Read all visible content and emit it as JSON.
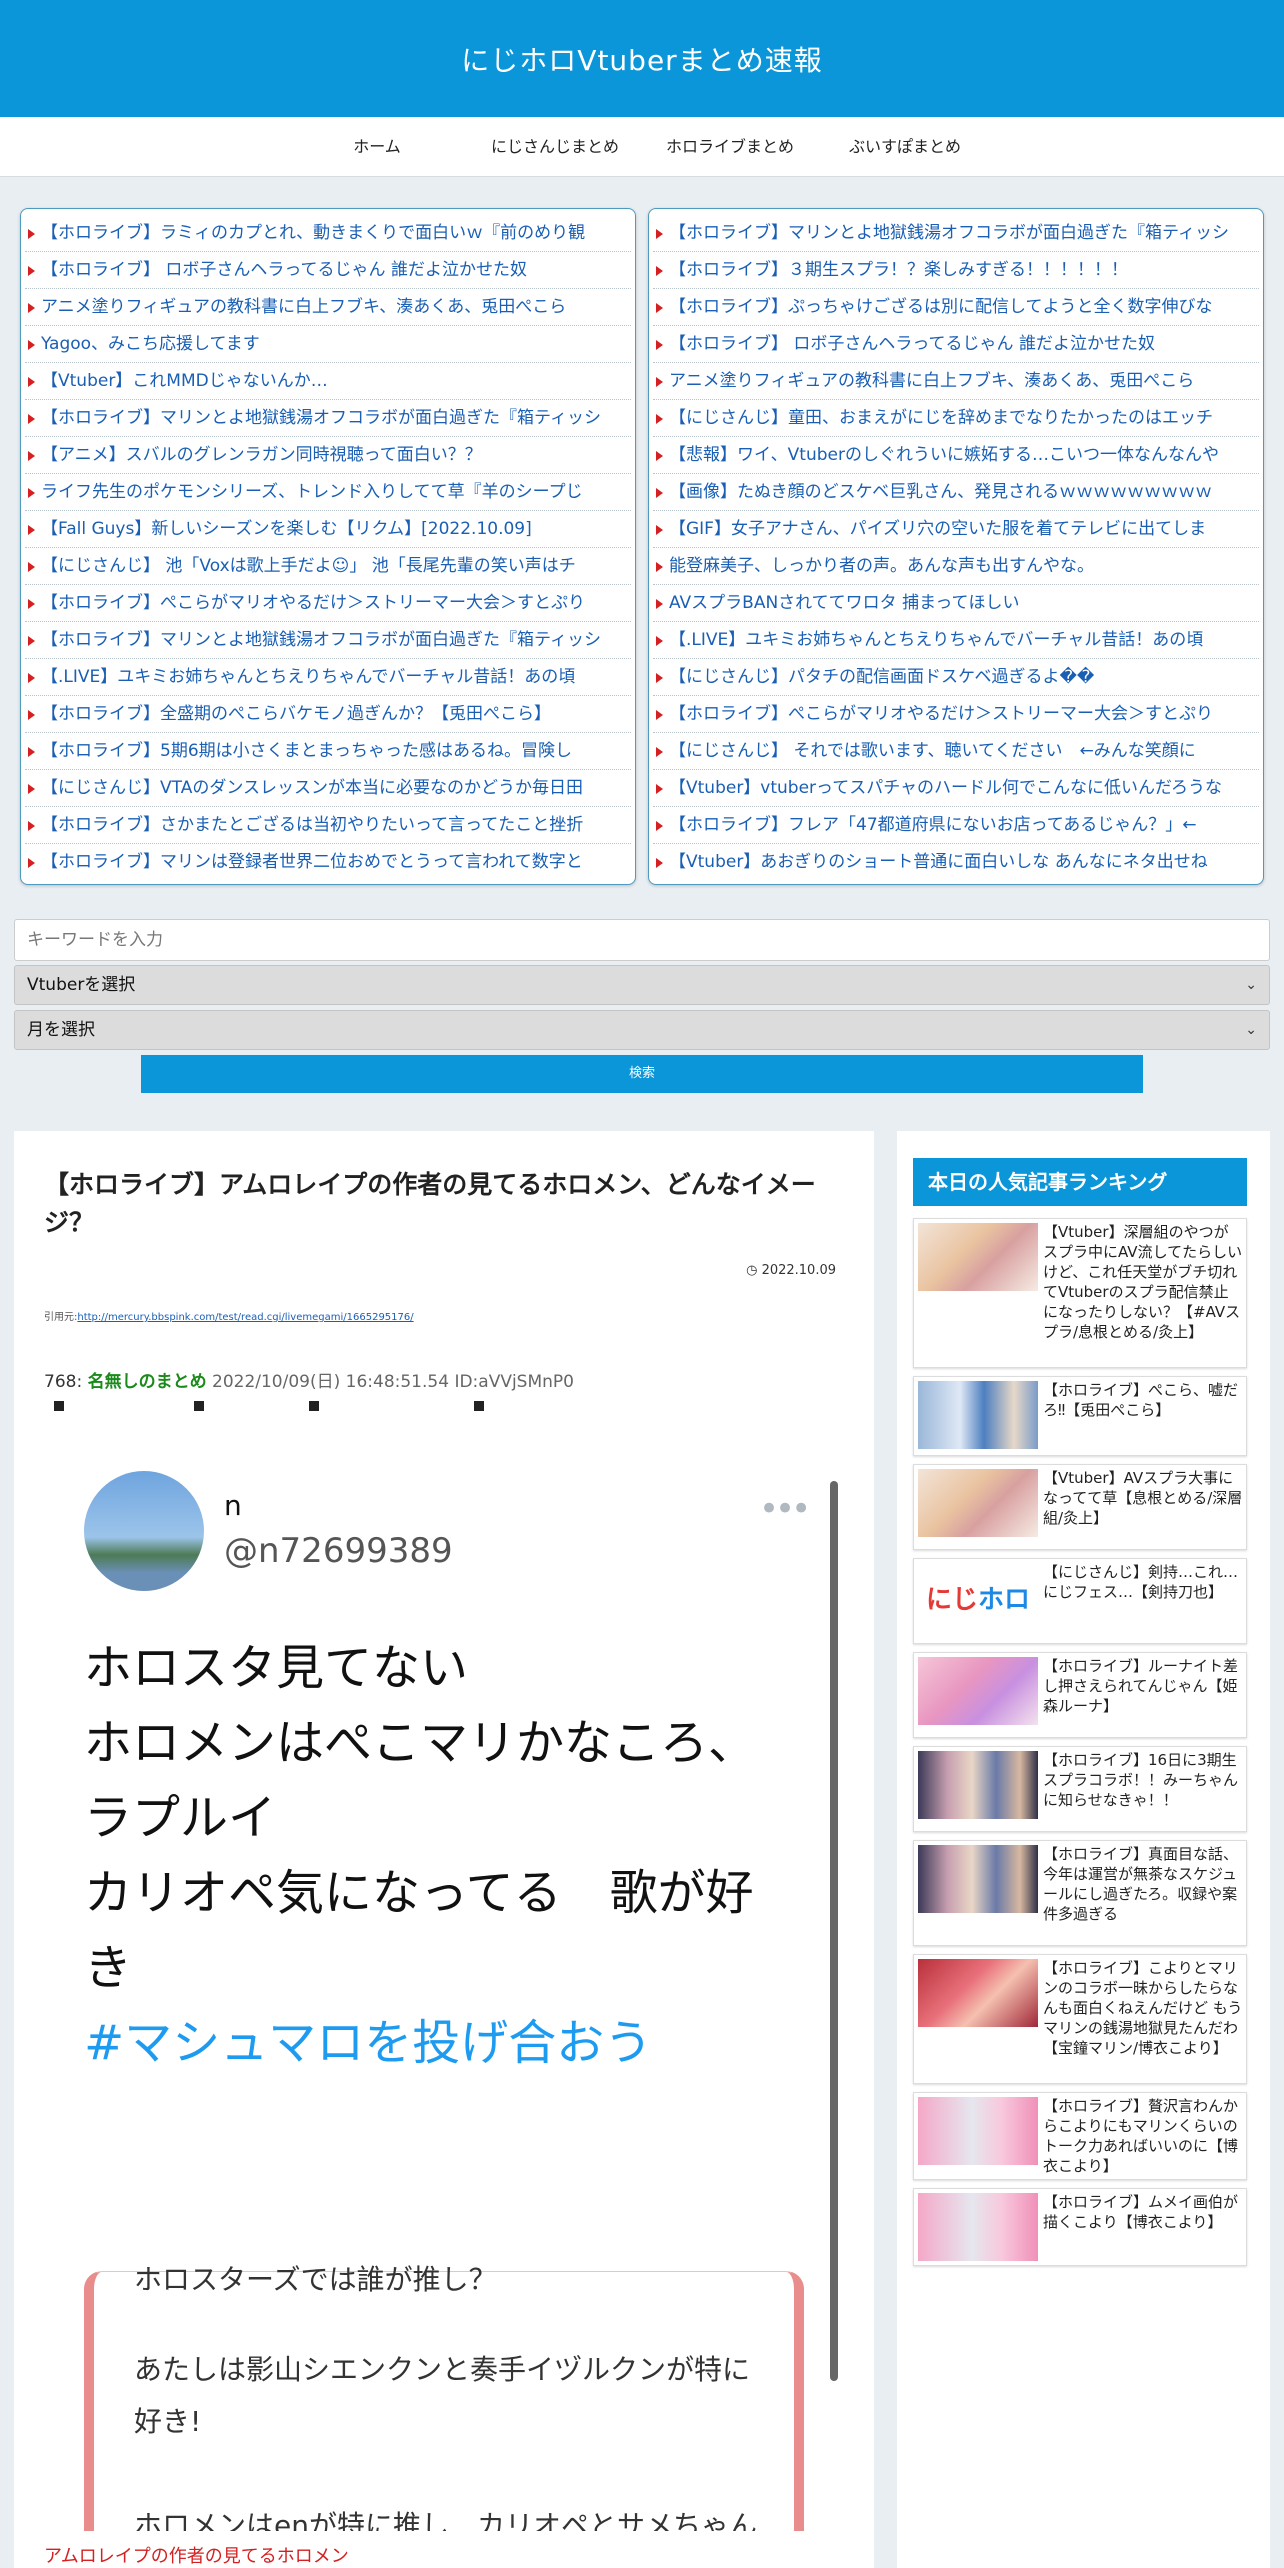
{
  "header": {
    "title": "にじホロVtuberまとめ速報"
  },
  "nav": {
    "items": [
      "ホーム",
      "にじさんじまとめ",
      "ホロライブまとめ",
      "ぶいすぽまとめ"
    ]
  },
  "feeds": {
    "left": [
      "【ホロライブ】ラミィのカプとれ、動きまくりで面白いｗ『前のめり観",
      "【ホロライブ】 ロボ子さんヘラってるじゃん 誰だよ泣かせた奴",
      "アニメ塗りフィギュアの教科書に白上フブキ、湊あくあ、兎田ぺこら",
      "Yagoo、みこち応援してます",
      "【Vtuber】これMMDじゃないんか…",
      "【ホロライブ】マリンとよ地獄銭湯オフコラボが面白過ぎた『箱ティッシ",
      "【アニメ】スバルのグレンラガン同時視聴って面白い？？",
      "ライフ先生のポケモンシリーズ、トレンド入りしてて草『羊のシープじ",
      "【Fall Guys】新しいシーズンを楽しむ【リクム】[2022.10.09]",
      "【にじさんじ】 池「Voxは歌上手だよ☺」 池「長尾先輩の笑い声はチ",
      "【ホロライブ】ぺこらがマリオやるだけ＞ストリーマー大会＞すとぷり",
      "【ホロライブ】マリンとよ地獄銭湯オフコラボが面白過ぎた『箱ティッシ",
      "【.LIVE】ユキミお姉ちゃんとちえりちゃんでバーチャル昔話！あの頃",
      "【ホロライブ】全盛期のぺこらバケモノ過ぎんか？【兎田ぺこら】",
      "【ホロライブ】5期6期は小さくまとまっちゃった感はあるね。冒険し",
      "【にじさんじ】VTAのダンスレッスンが本当に必要なのかどうか毎日田",
      "【ホロライブ】さかまたとござるは当初やりたいって言ってたこと挫折",
      "【ホロライブ】マリンは登録者世界二位おめでとうって言われて数字と"
    ],
    "right": [
      "【ホロライブ】マリンとよ地獄銭湯オフコラボが面白過ぎた『箱ティッシ",
      "【ホロライブ】３期生スプラ！？楽しみすぎる！！！！！！",
      "【ホロライブ】ぷっちゃけござるは別に配信してようと全く数字伸びな",
      "【ホロライブ】 ロボ子さんヘラってるじゃん 誰だよ泣かせた奴",
      "アニメ塗りフィギュアの教科書に白上フブキ、湊あくあ、兎田ぺこら",
      "【にじさんじ】童田、おまえがにじを辞めまでなりたかったのはエッチ",
      "【悲報】ワイ、Vtuberのしぐれういに嫉妬する…こいつ一体なんなんや",
      "【画像】たぬき顔のどスケベ巨乳さん、発見されるｗｗｗｗｗｗｗｗｗ",
      "【GIF】女子アナさん、パイズリ穴の空いた服を着てテレビに出てしま",
      "能登麻美子、しっかり者の声。あんな声も出すんやな。",
      "AVスプラBANされててワロタ 捕まってほしい",
      "【.LIVE】ユキミお姉ちゃんとちえりちゃんでバーチャル昔話！あの頃",
      "【にじさんじ】パタチの配信画面ドスケベ過ぎるよ��",
      "【ホロライブ】ぺこらがマリオやるだけ＞ストリーマー大会＞すとぷり",
      "【にじさんじ】 それでは歌います、聴いてください　←みんな笑顔に",
      "【Vtuber】vtuberってスパチャのハードル何でこんなに低いんだろうな",
      "【ホロライブ】フレア「47都道府県にないお店ってあるじゃん？」←",
      "【Vtuber】あおぎりのショート普通に面白いしな あんなにネタ出せね"
    ]
  },
  "search": {
    "placeholder": "キーワードを入力",
    "vtuber_select": "Vtuberを選択",
    "month_select": "月を選択",
    "button": "検索"
  },
  "article": {
    "title": "【ホロライブ】アムロレイプの作者の見てるホロメン、どんなイメージ？",
    "date": "2022.10.09",
    "source_label": "引用元:",
    "source_url": "http://mercury.bbspink.com/test/read.cgi/livemegami/1665295176/",
    "post_number": "768:",
    "post_name": "名無しのまとめ",
    "post_meta": "2022/10/09(日) 16:48:51.54 ID:aVVjSMnP0",
    "tweet": {
      "name": "n",
      "handle": "@n72699389",
      "lines": [
        "ホロスタ見てない",
        "ホロメンはぺこマリかなころ、",
        "ラプルイ",
        "カリオペ気になってる　歌が好",
        "き"
      ],
      "hashtag": "#マシュマロを投げ合おう",
      "card_top": "ホロスターズでは誰が推し？",
      "card_p1": "あたしは影山シエンクンと奏手イヅルクンが特に好き!",
      "card_p2": "ホロメンはenが特に推し　カリオペとサメちゃんかなー"
    },
    "footer_red": "アムロレイプの作者の見てるホロメン"
  },
  "sidebar": {
    "ranking_title": "本日の人気記事ランキング",
    "items": [
      "【Vtuber】深層組のやつがスプラ中にAV流してたらしいけど、これ任天堂がブチ切れてVtuberのスプラ配信禁止になったりしない？【#AVスプラ/息根とめる/灸上】",
      "【ホロライブ】ぺこら、嘘だろ‼【兎田ぺこら】",
      "【Vtuber】AVスプラ大事になってて草【息根とめる/深層組/灸上】",
      "【にじさんじ】剣持…これ…にじフェス…【剣持刀也】",
      "【ホロライブ】ルーナイト差し押さえられてんじゃん【姫森ルーナ】",
      "【ホロライブ】16日に3期生スプラコラボ！！みーちゃんに知らせなきゃ！！",
      "【ホロライブ】真面目な話、今年は運営が無茶なスケジュールにし過ぎたろ。収録や案件多過ぎる",
      "【ホロライブ】こよりとマリンのコラボ一昧からしたらなんも面白くねえんだけど もうマリンの銭湯地獄見たんだわ【宝鐘マリン/博衣こより】",
      "【ホロライブ】贅沢言わんからこよりにもマリンくらいのトーク力あればいいのに【博衣こより】",
      "【ホロライブ】ムメイ画伯が描くこより【博衣こより】"
    ],
    "logo_text_a": "にじ",
    "logo_text_b": "ホロ"
  },
  "colors": {
    "accent": "#0b96d9",
    "link": "#1a5fb4",
    "bullet": "#d42020",
    "post_name": "#1a8a1a"
  }
}
